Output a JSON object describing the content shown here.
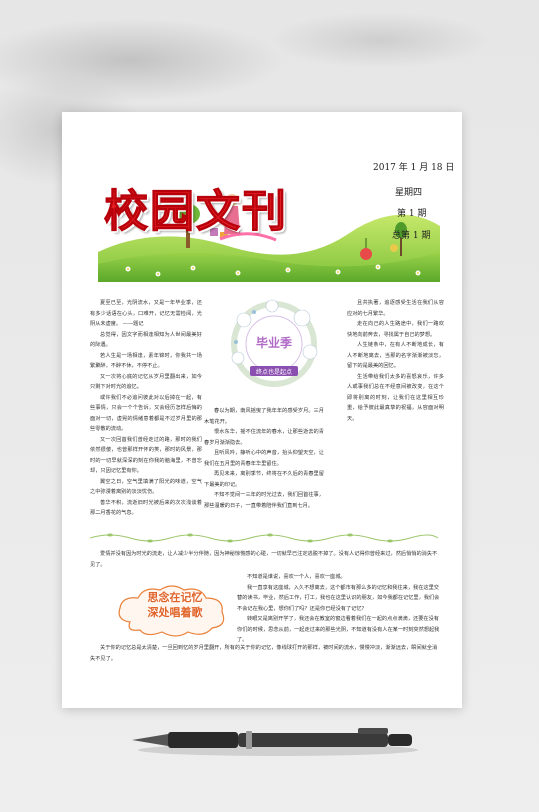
{
  "masthead": {
    "title": "校园文刊",
    "date": "2017 年 1 月 18 日",
    "weekday": "星期四",
    "issue": "第 1 期",
    "total_issue": "总第 1 期"
  },
  "feature": {
    "badge_title": "毕业季",
    "badge_ribbon": "终点也是起点"
  },
  "left_column": [
    "夏至已至，光阴流水，又是一年毕业季，还有多少话语在心头，口难开，记忆无需检阅，光阴从未虚度。 ——题记",
    "总觉得，因文字而相逢相知为人世间最美好的际遇。",
    "若人生是一场相逢，素年锦时，你我共一场繁聚醉，不醉不休，不停不止。",
    "又一次将心底的记忆从岁月里翻出来，如今只剩下对时光的追忆。",
    "或许我们不必追问彼此对以后掉在一起，有些事情，只会一个个告诉，又会经历怎样后悔的面对一切，虚晃的情绪意着都是不过岁月里的那些零散的流动。",
    "又一次回首我们曾经走过的路，那时的我们依然很傻，也曾那样开怀的笑，那时的风景，那时的一切早就深深的刻在你我的脑海里，不曾忘却，只因记忆里有你。",
    "翼空之日，空气里填满了阳光的味道，空气之中弥漫着离别的淡淡忧伤。",
    "善华不积，流逝旧时光被后来的次次浅谈着那二月香花的气息。"
  ],
  "middle_column": [
    "春以为期，南风摇曳了我年年的感受岁月。三月木笔花开。",
    "恨水东华，摇不住流年的春水，让那些逝去的青春岁月渐渐隐去。",
    "且听风吟，静听心中的声音，抬头仰望天空，让我们在五月里的青春年华里留住。",
    "再见未来，离别季节，终将在不久后的青春里留下最美的印记。",
    "不知不觉间一三年的时光过去，我们回首往事，那些温暖的日子，一直带着陪伴我们直到七月。"
  ],
  "right_column": [
    "且共执著，追逐感受生活在我们从容应对的七月繁华。",
    "走在向己的人生路途中，我们一路欢快地向前奔去，寻找属于自己的梦想。",
    "人生链条中，在有人不断地成长，有人不断地离去，当那的名字渐渐被淡忘，留下的是最美的回忆。",
    "生活带给我们太多的喜怒哀乐，许多人或事我们总在不经意间被改变，在这个即将别离的时刻，让我们在这里相互珍重，给予彼此最真挚的祝福，从容面对明天。"
  ],
  "bottom": {
    "intro": "爱情并没有因为时光的流走，让人减少半分伴随，因为神秘惊慌感的心碰，一切就早已注定逃脱不掉了。没有人记得你曾经来过，然后悄悄的消失不见了。",
    "cloud_line1": "思念在记忆",
    "cloud_line2": "深处唱着歌",
    "right_paragraphs": [
      "不知道是谁说，喜欢一个人，喜欢一座城。",
      "我一直享有这座城，入久不想离去，这个都市有那么多的记忆和我往来，我在这里交替的读书，毕业，然后工作，打工，我也在这里认识的朋友，如今我都在记忆里，我们会不会记在我心里，想你们了吗？还是你已经没有了记忆？",
      "转眼又是离别开学了，我还会在教室的窗边看着我们在一起的点点滴滴，还要在没有你们的时候，思念从前，一起走过来的那些光阴，不知道有没有人在某一时刻突然想起我了。"
    ],
    "closing": "关于你的记忆总是太清楚，一旦回到忆的岁月里翻开，所有的关于你的记忆，像线球打开的那样，被时间的流水，慢慢冲淡，渐渐远去，瞬间就全消失不见了。"
  },
  "colors": {
    "title_red": "#e31c25",
    "accent_orange": "#e0642a",
    "badge_purple": "#8a4fb0"
  }
}
